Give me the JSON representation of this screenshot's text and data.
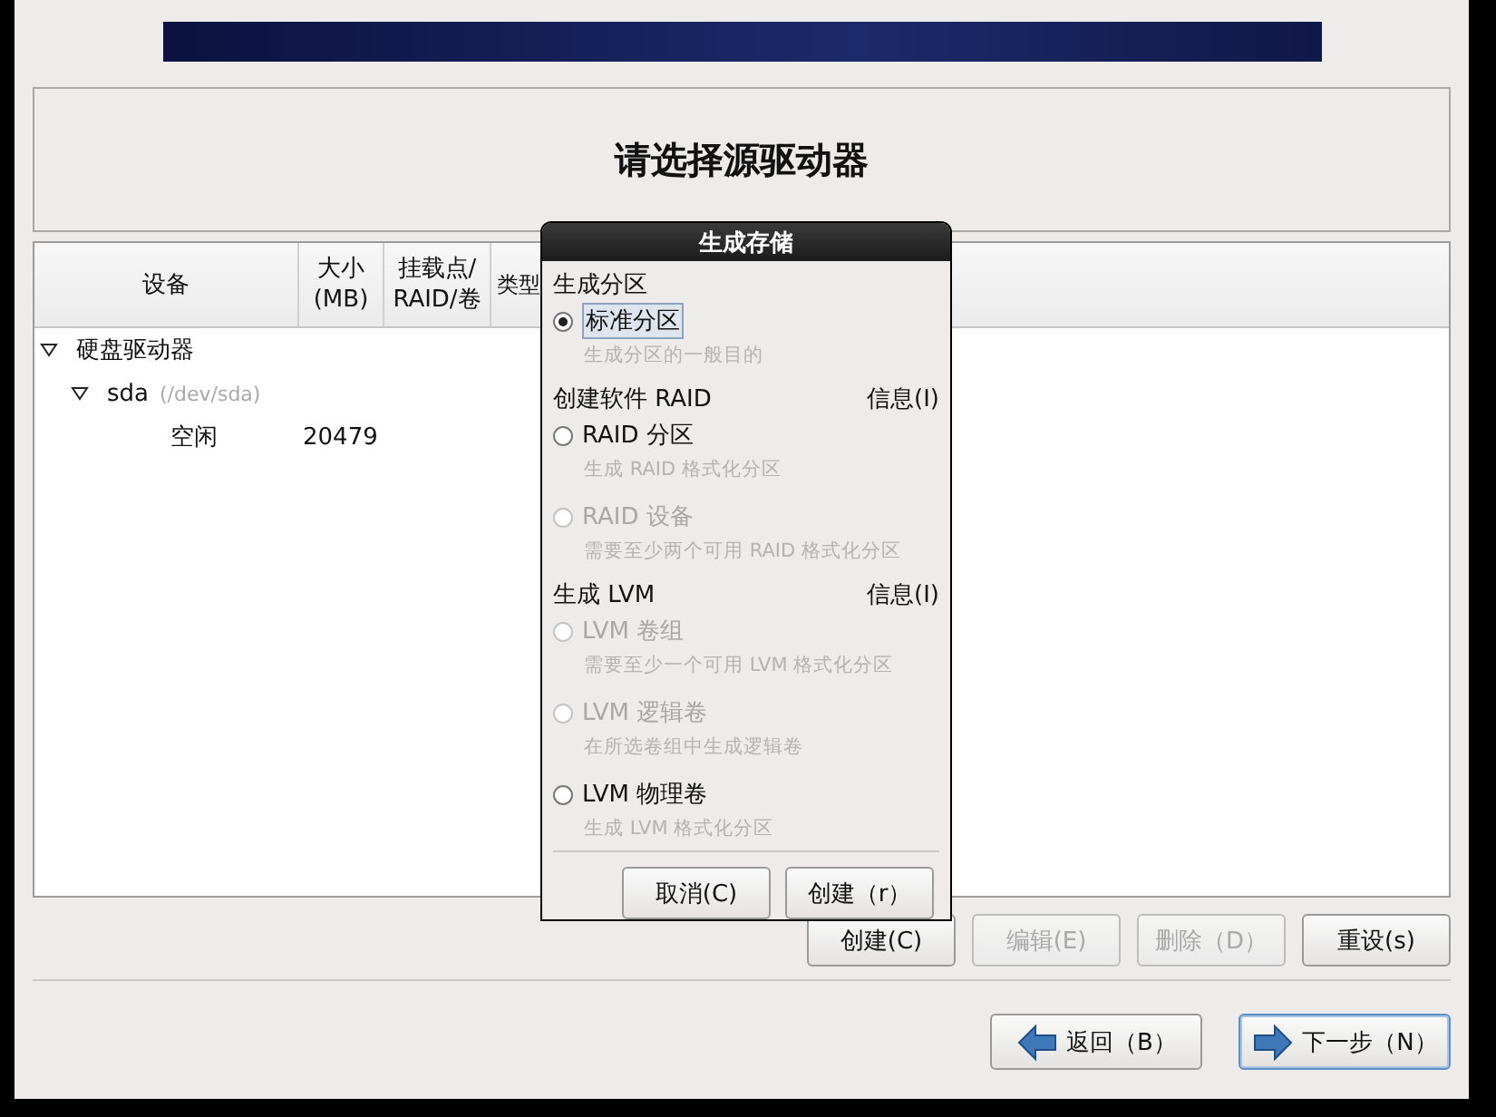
{
  "title": "请选择源驱动器",
  "table": {
    "columns": [
      {
        "lines": [
          "设备"
        ]
      },
      {
        "lines": [
          "大小",
          "(MB)"
        ]
      },
      {
        "lines": [
          "挂载点/",
          "RAID/卷"
        ]
      },
      {
        "lines": [
          "类型"
        ]
      }
    ],
    "rows": [
      {
        "device": "硬盘驱动器",
        "expanded": true,
        "children": [
          {
            "device": "sda",
            "detail": "(/dev/sda)",
            "expanded": true,
            "children": [
              {
                "device": "空闲",
                "size": "20479"
              }
            ]
          }
        ]
      }
    ]
  },
  "buttons": [
    {
      "label": "创建(C)",
      "disabled": false
    },
    {
      "label": "编辑(E)",
      "disabled": true
    },
    {
      "label": "删除（D）",
      "disabled": true
    },
    {
      "label": "重设(s)",
      "disabled": false
    }
  ],
  "nav": [
    {
      "label": "返回（B）",
      "kind": "back",
      "focused": false
    },
    {
      "label": "下一步（N）",
      "kind": "next",
      "focused": true
    }
  ],
  "dialog": {
    "title": "生成存储",
    "sections": [
      {
        "heading": "生成分区",
        "options": [
          {
            "label": "标准分区",
            "hint": "生成分区的一般目的",
            "selected": true,
            "disabled": false
          }
        ]
      },
      {
        "heading": "创建软件 RAID",
        "info": "信息(I)",
        "options": [
          {
            "label": "RAID 分区",
            "hint": "生成 RAID 格式化分区",
            "selected": false,
            "disabled": false
          },
          {
            "label": "RAID 设备",
            "hint": "需要至少两个可用 RAID 格式化分区",
            "selected": false,
            "disabled": true
          }
        ]
      },
      {
        "heading": "生成 LVM",
        "info": "信息(I)",
        "options": [
          {
            "label": "LVM 卷组",
            "hint": "需要至少一个可用 LVM 格式化分区",
            "selected": false,
            "disabled": true
          },
          {
            "label": "LVM 逻辑卷",
            "hint": "在所选卷组中生成逻辑卷",
            "selected": false,
            "disabled": true
          },
          {
            "label": "LVM 物理卷",
            "hint": "生成 LVM 格式化分区",
            "selected": false,
            "disabled": false
          }
        ]
      }
    ],
    "buttons": [
      "取消(C)",
      "创建（r）"
    ]
  }
}
